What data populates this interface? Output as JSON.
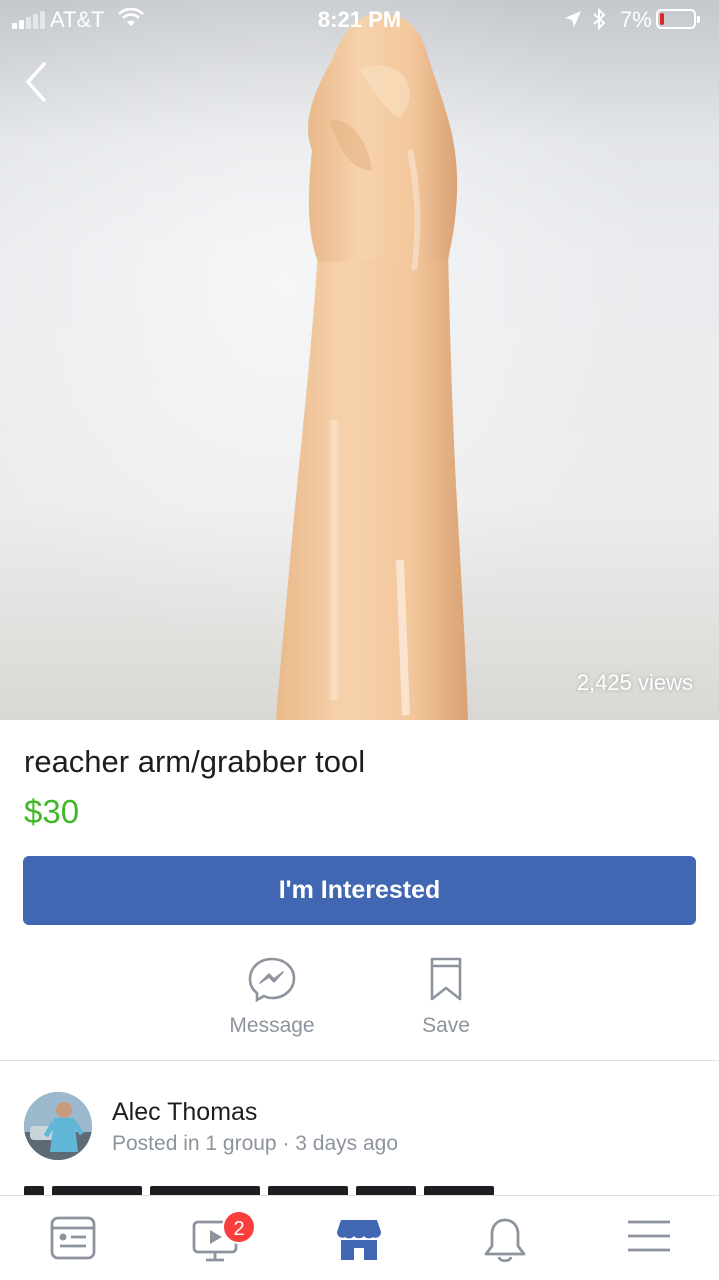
{
  "status_bar": {
    "carrier": "AT&T",
    "time": "8:21 PM",
    "battery_percent": "7%",
    "battery_level": 0.07
  },
  "listing": {
    "views": "2,425 views",
    "title": "reacher arm/grabber tool",
    "price": "$30",
    "interested_label": "I'm Interested"
  },
  "actions": {
    "message_label": "Message",
    "save_label": "Save"
  },
  "seller": {
    "name": "Alec Thomas",
    "meta": "Posted in 1 group · 3 days ago"
  },
  "tabbar": {
    "video_badge": "2",
    "active_tab": "marketplace"
  },
  "colors": {
    "brand_blue": "#4267b2",
    "price_green": "#42b72a",
    "badge_red": "#fa3e3e",
    "secondary_text": "#8d949e"
  },
  "icons": [
    "back-chevron-icon",
    "wifi-icon",
    "location-arrow-icon",
    "bluetooth-icon",
    "battery-icon",
    "messenger-icon",
    "bookmark-icon",
    "news-feed-icon",
    "video-icon",
    "marketplace-icon",
    "bell-icon",
    "menu-icon"
  ]
}
